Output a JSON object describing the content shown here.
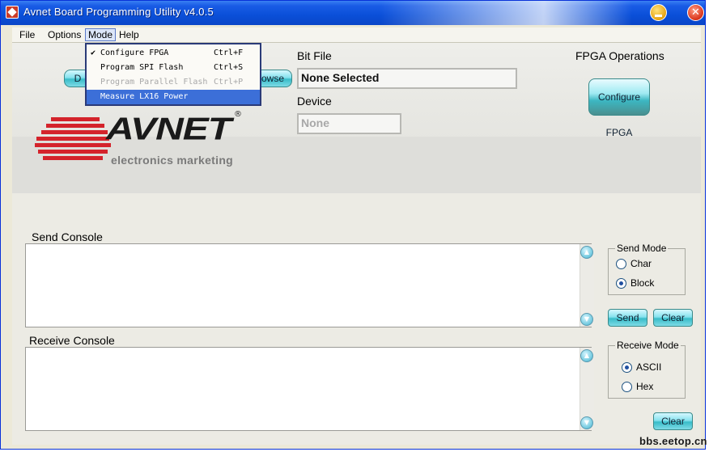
{
  "window": {
    "title": "Avnet Board Programming Utility v4.0.5"
  },
  "menu": {
    "items": [
      "File",
      "Options",
      "Mode",
      "Help"
    ],
    "mode_dropdown": [
      {
        "label": "Configure FPGA",
        "shortcut": "Ctrl+F",
        "checked": "✔"
      },
      {
        "label": "Program SPI Flash",
        "shortcut": "Ctrl+S",
        "checked": ""
      },
      {
        "label": "Program Parallel Flash",
        "shortcut": "Ctrl+P",
        "checked": ""
      },
      {
        "label": "Measure LX16 Power",
        "shortcut": "",
        "checked": ""
      }
    ]
  },
  "buttons": {
    "clipped_left": "D",
    "clipped_right": "owse"
  },
  "bitfile": {
    "label": "Bit File",
    "value": "None Selected"
  },
  "device": {
    "label": "Device",
    "value": "None"
  },
  "fpga_ops": {
    "label": "FPGA Operations",
    "configure": "Configure FPGA"
  },
  "logo": {
    "word": "AVNET",
    "reg": "®",
    "sub": "electronics marketing"
  },
  "send_console": {
    "label": "Send Console"
  },
  "receive_console": {
    "label": "Receive Console"
  },
  "send_mode": {
    "title": "Send Mode",
    "options": [
      "Char",
      "Block"
    ],
    "selected": "Block"
  },
  "receive_mode": {
    "title": "Receive Mode",
    "options": [
      "ASCII",
      "Hex"
    ],
    "selected": "ASCII"
  },
  "actions": {
    "send": "Send",
    "clear": "Clear"
  },
  "watermark": "bbs.eetop.cn",
  "icons": {
    "scroll_up": "▲",
    "scroll_down": "▼",
    "close": "✕"
  },
  "colors": {
    "accent": "#0a4fd8",
    "menu_highlight": "#3c6fd8",
    "logo_red": "#d4232b"
  }
}
